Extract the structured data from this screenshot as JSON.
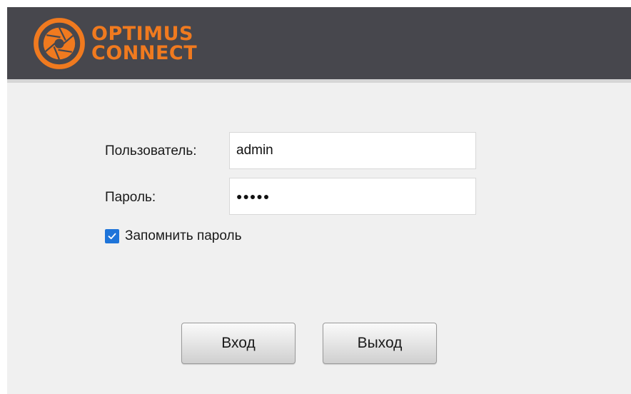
{
  "logo": {
    "line1": "OPTIMUS",
    "line2": "CONNECT",
    "brand_color": "#f07a1f",
    "icon": "optimus-aperture-logo"
  },
  "header": {
    "background": "#47474d"
  },
  "form": {
    "username_label": "Пользователь:",
    "username_value": "admin",
    "password_label": "Пароль:",
    "password_mask": "●●●●●",
    "remember_label": "Запомнить пароль",
    "remember_checked": true
  },
  "buttons": {
    "login_label": "Вход",
    "exit_label": "Выход"
  },
  "colors": {
    "accent": "#1e74d9",
    "window_bg": "#f0f0f0"
  }
}
